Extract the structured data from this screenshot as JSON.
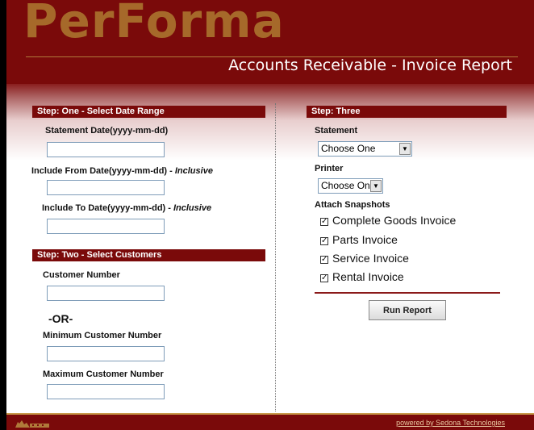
{
  "header": {
    "logo": "PerForma",
    "title": "Accounts Receivable - Invoice Report"
  },
  "step1": {
    "heading": "Step: One - Select Date Range",
    "statement_date_label": "Statement Date(yyyy-mm-dd)",
    "from_label": "Include From Date(yyyy-mm-dd) - ",
    "to_label": "Include To Date(yyyy-mm-dd) - ",
    "inclusive": "Inclusive",
    "statement_date_value": "",
    "from_value": "",
    "to_value": ""
  },
  "step2": {
    "heading": "Step: Two - Select Customers",
    "customer_number_label": "Customer Number",
    "or_text": "-OR-",
    "min_label": "Minimum Customer Number",
    "max_label": "Maximum Customer Number",
    "customer_number_value": "",
    "min_value": "",
    "max_value": ""
  },
  "step3": {
    "heading": "Step: Three",
    "statement_label": "Statement",
    "statement_selected": "Choose One",
    "printer_label": "Printer",
    "printer_selected": "Choose One",
    "snapshots_label": "Attach Snapshots",
    "snapshots": [
      {
        "label": "Complete Goods Invoice",
        "checked": true
      },
      {
        "label": "Parts Invoice",
        "checked": true
      },
      {
        "label": "Service Invoice",
        "checked": true
      },
      {
        "label": "Rental Invoice",
        "checked": true
      }
    ],
    "run_button": "Run Report"
  },
  "footer": {
    "powered_by": "powered by Sedona Technologies"
  },
  "icons": {
    "select_arrow": "chevron-down-icon",
    "checkbox_mark": "check-icon",
    "footer_logo": "sedona-logo-icon"
  },
  "colors": {
    "brand": "#7a0a0a",
    "logo_gold": "#a6692a"
  }
}
